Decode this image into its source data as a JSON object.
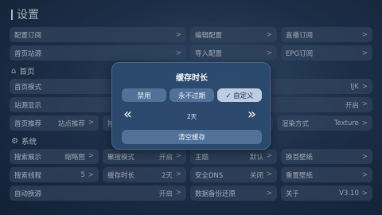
{
  "page_title": "设置",
  "arrow": ">",
  "rows": {
    "r1": [
      {
        "label": "配置订阅",
        "value": ""
      },
      {
        "label": "编辑配置",
        "value": ""
      },
      {
        "label": "直播订阅",
        "value": ""
      }
    ],
    "r2": [
      {
        "label": "首页站源",
        "value": ""
      },
      {
        "label": "导入配置",
        "value": ""
      },
      {
        "label": "EPG订阅",
        "value": ""
      }
    ],
    "r3": [
      {
        "label": "首页模式",
        "value": "IJK"
      }
    ],
    "r4": [
      {
        "label": "站源显示",
        "value": "开启"
      }
    ],
    "r5": [
      {
        "label": "首页推荐",
        "value": "站点推荐"
      },
      {
        "label": "按",
        "value": ""
      },
      {
        "label": "渲染方式",
        "value": "Texture"
      }
    ],
    "r6": [
      {
        "label": "搜索展示",
        "value": "缩略图"
      },
      {
        "label": "聚搜模式",
        "value": "开启"
      },
      {
        "label": "主题",
        "value": "默认"
      },
      {
        "label": "换首壁纸",
        "value": ""
      }
    ],
    "r7": [
      {
        "label": "搜索线程",
        "value": "5"
      },
      {
        "label": "缓存时长",
        "value": "2天"
      },
      {
        "label": "安全DNS",
        "value": "关闭"
      },
      {
        "label": "重置壁纸",
        "value": ""
      }
    ],
    "r8": [
      {
        "label": "自动换源",
        "value": "开启"
      },
      {
        "label": "数据备份还原",
        "value": ""
      },
      {
        "label": "关于",
        "value": "V3.10"
      }
    ]
  },
  "sections": {
    "home": "首页",
    "system": "系统"
  },
  "dialog": {
    "title": "缓存时长",
    "options": [
      "禁用",
      "永不过期",
      "✓ 自定义"
    ],
    "selected_index": 2,
    "value": "2天",
    "left_chevron": "«",
    "right_chevron": "»",
    "clear_label": "清空缓存"
  }
}
